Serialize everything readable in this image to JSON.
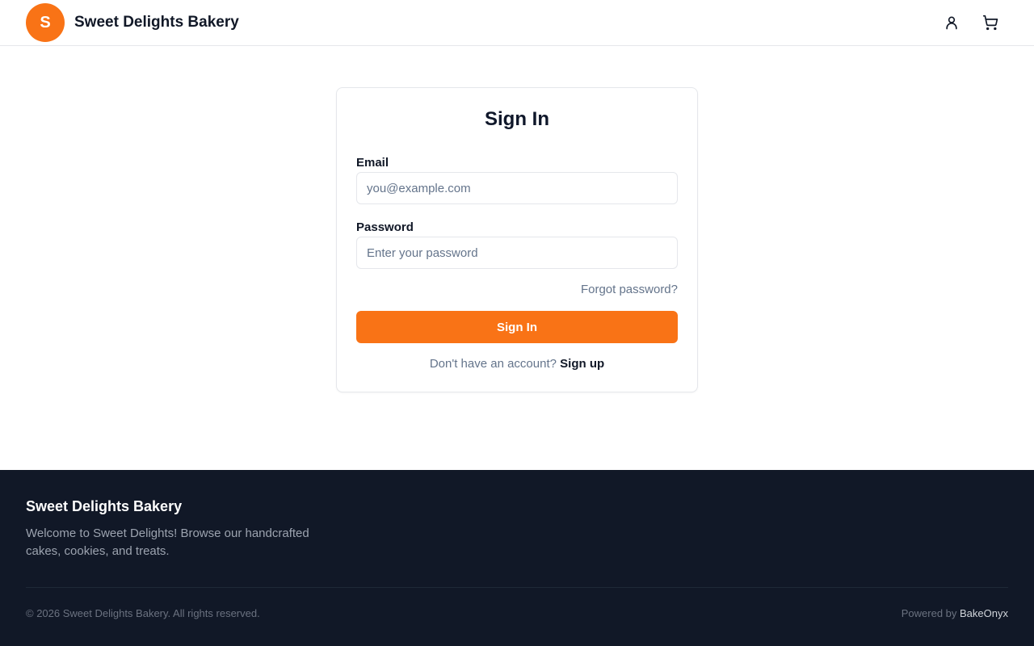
{
  "header": {
    "avatar_letter": "S",
    "brand_name": "Sweet Delights Bakery",
    "icons": [
      "user-icon",
      "cart-icon"
    ],
    "accent_color": "#f97316"
  },
  "signin": {
    "title": "Sign In",
    "email_label": "Email",
    "email_placeholder": "you@example.com",
    "email_value": "",
    "password_label": "Password",
    "password_placeholder": "Enter your password",
    "password_value": "",
    "forgot_link": "Forgot password?",
    "submit_label": "Sign In",
    "signup_prompt": "Don't have an account?",
    "signup_link": "Sign up"
  },
  "footer": {
    "title": "Sweet Delights Bakery",
    "description": "Welcome to Sweet Delights! Browse our handcrafted cakes, cookies, and treats.",
    "copyright": "© 2026 Sweet Delights Bakery. All rights reserved.",
    "powered_prefix": "Powered by",
    "powered_brand": "BakeOnyx",
    "background_color": "#111827"
  }
}
